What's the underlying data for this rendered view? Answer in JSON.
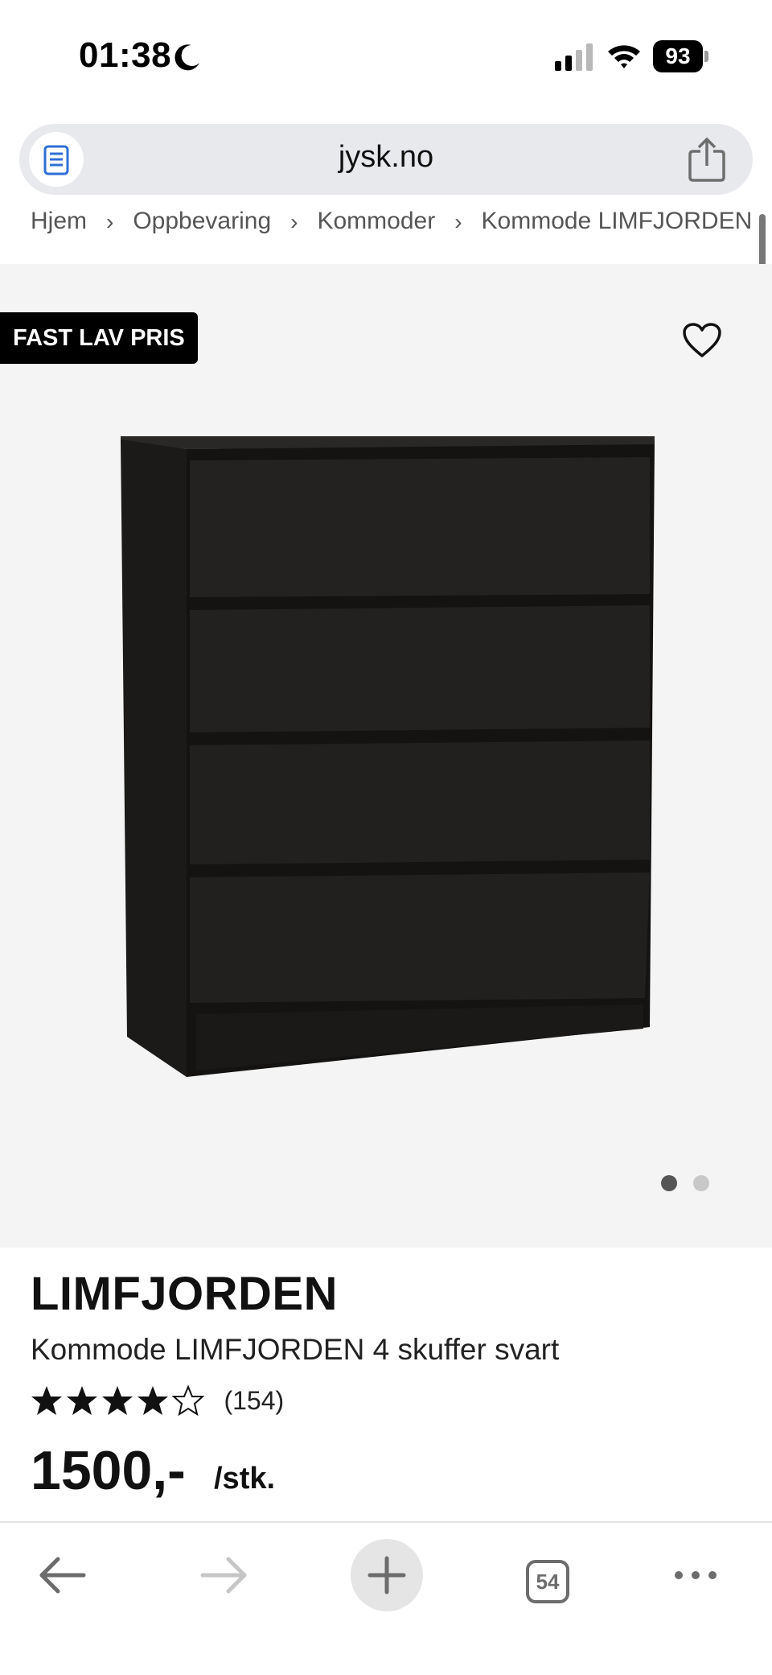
{
  "status_bar": {
    "time": "01:38",
    "battery": "93",
    "icons": [
      "moon-icon",
      "signal-icon",
      "wifi-icon",
      "battery-icon"
    ]
  },
  "browser": {
    "url": "jysk.no",
    "icons": [
      "reader-icon",
      "share-icon"
    ]
  },
  "breadcrumb": {
    "items": [
      "Hjem",
      "Oppbevaring",
      "Kommoder",
      "Kommode LIMFJORDEN"
    ]
  },
  "product": {
    "badge": "FAST LAV PRIS",
    "brand": "LIMFJORDEN",
    "description": "Kommode LIMFJORDEN 4 skuffer svart",
    "rating": 4,
    "rating_max": 5,
    "reviews": "(154)",
    "price": "1500,-",
    "unit": "/stk.",
    "image_count": 2,
    "active_image": 1,
    "colors": {
      "furniture": "#1c1a18",
      "badge": "#000000"
    }
  },
  "toolbar": {
    "tabs_count": "54",
    "icons": [
      "back-icon",
      "forward-icon",
      "new-tab-icon",
      "tabs-icon",
      "more-icon"
    ]
  }
}
